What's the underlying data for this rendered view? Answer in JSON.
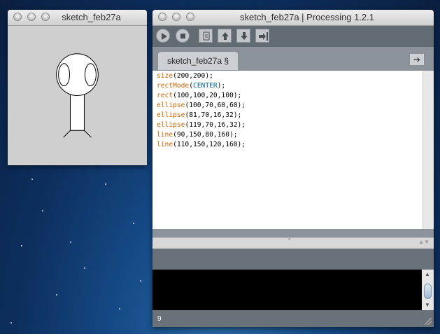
{
  "sketch_window": {
    "title": "sketch_feb27a"
  },
  "ide_window": {
    "title": "sketch_feb27a | Processing 1.2.1",
    "tab_label": "sketch_feb27a §",
    "tab_arrow": "➔",
    "code": [
      [
        {
          "t": "size",
          "c": "kw"
        },
        {
          "t": "(200,200);"
        }
      ],
      [
        {
          "t": "rectMode",
          "c": "kw"
        },
        {
          "t": "("
        },
        {
          "t": "CENTER",
          "c": "const"
        },
        {
          "t": ");"
        }
      ],
      [
        {
          "t": "rect",
          "c": "kw"
        },
        {
          "t": "(100,100,20,100);"
        }
      ],
      [
        {
          "t": "ellipse",
          "c": "kw"
        },
        {
          "t": "(100,70,60,60);"
        }
      ],
      [
        {
          "t": "ellipse",
          "c": "kw"
        },
        {
          "t": "(81,70,16,32);"
        }
      ],
      [
        {
          "t": "ellipse",
          "c": "kw"
        },
        {
          "t": "(119,70,16,32);"
        }
      ],
      [
        {
          "t": "line",
          "c": "kw"
        },
        {
          "t": "(90,150,80,160);"
        }
      ],
      [
        {
          "t": "line",
          "c": "kw"
        },
        {
          "t": "(110,150,120,160);"
        }
      ]
    ],
    "divider_handle": "ˆ",
    "status_line": "9"
  },
  "toolbar": {
    "buttons": [
      "run",
      "stop",
      "new",
      "open",
      "save",
      "export"
    ]
  },
  "colors": {
    "keyword": "#cc6600",
    "constant": "#006699",
    "toolbar_bg": "#626a72"
  }
}
